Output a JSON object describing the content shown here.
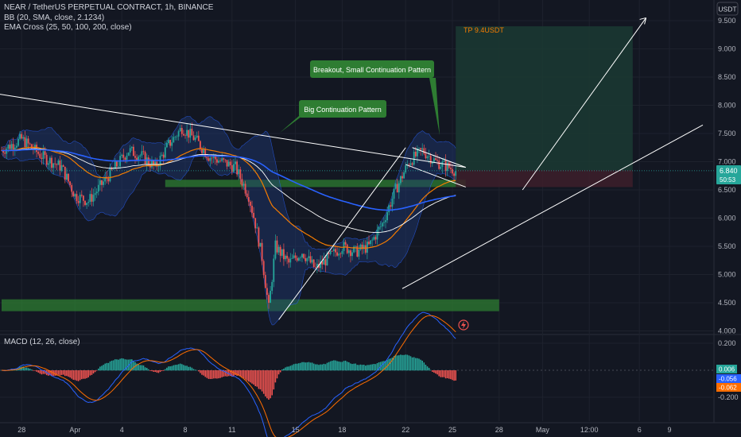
{
  "legend": {
    "symbol": "NEAR / TetherUS PERPETUAL CONTRACT, 1h, BINANCE",
    "bb": "BB (20, SMA, close, 2.1234)",
    "ema": "EMA Cross (25, 50, 100, 200, close)",
    "macd": "MACD (12, 26, close)"
  },
  "currency": "USDT",
  "annotations": {
    "big_pattern": "Big Continuation Pattern",
    "breakout": "Breakout, Small Continuation Pattern",
    "tp": "TP 9.4USDT"
  },
  "price_tag": {
    "value": "6.840",
    "countdown": "50:53"
  },
  "macd_tags": {
    "a": "0.006",
    "b": "-0.056",
    "c": "-0.062"
  },
  "colors": {
    "background": "#131722",
    "grid": "#1e222d",
    "text": "#b2b5be",
    "candle_up": "#26a69a",
    "candle_down": "#ef5350",
    "ema_fast": "#f57c00",
    "ema_white": "#ffffff",
    "ema_blue": "#2962ff",
    "bb_fill": "#1e3a75",
    "support_zone": "#2e7d32",
    "callout": "#2e7d32",
    "tp_zone": "#1b3a33",
    "sl_zone": "#3d1f2a",
    "price_tag": "#26a69a",
    "macd_line": "#2962ff",
    "signal_line": "#ff6d00"
  },
  "chart_data": {
    "type": "candlestick",
    "y_axis": {
      "ticks": [
        "9.500",
        "9.000",
        "8.500",
        "8.000",
        "7.500",
        "7.000",
        "6.500",
        "6.000",
        "5.500",
        "5.000",
        "4.500",
        "4.000"
      ],
      "ylim": [
        4.0,
        9.5
      ]
    },
    "x_axis": {
      "ticks": [
        "28",
        "Apr",
        "4",
        "8",
        "11",
        "15",
        "18",
        "22",
        "25",
        "28",
        "May",
        "12:00",
        "6",
        "9"
      ]
    },
    "macd_axis": {
      "ticks": [
        "0.200",
        "-0.200"
      ]
    },
    "price_path": [
      [
        0,
        7.2
      ],
      [
        6,
        7.4
      ],
      [
        12,
        7.1
      ],
      [
        18,
        6.9
      ],
      [
        22,
        6.4
      ],
      [
        26,
        6.3
      ],
      [
        30,
        6.6
      ],
      [
        34,
        6.9
      ],
      [
        38,
        7.2
      ],
      [
        42,
        7.1
      ],
      [
        46,
        6.9
      ],
      [
        50,
        7.3
      ],
      [
        54,
        7.6
      ],
      [
        58,
        7.4
      ],
      [
        62,
        7.1
      ],
      [
        66,
        7.0
      ],
      [
        70,
        6.9
      ],
      [
        74,
        6.4
      ],
      [
        76,
        5.9
      ],
      [
        78,
        5.3
      ],
      [
        80,
        4.4
      ],
      [
        82,
        5.5
      ],
      [
        86,
        5.2
      ],
      [
        90,
        5.4
      ],
      [
        94,
        5.1
      ],
      [
        98,
        5.3
      ],
      [
        102,
        5.5
      ],
      [
        106,
        5.4
      ],
      [
        110,
        5.5
      ],
      [
        114,
        5.9
      ],
      [
        118,
        6.5
      ],
      [
        122,
        7.0
      ],
      [
        126,
        7.2
      ],
      [
        130,
        7.0
      ],
      [
        134,
        6.9
      ],
      [
        136,
        6.84
      ]
    ],
    "trendlines": [
      {
        "from": [
          -1,
          8.2
        ],
        "to": [
          139,
          6.9
        ]
      },
      {
        "from": [
          83,
          4.2
        ],
        "to": [
          121,
          7.25
        ]
      },
      {
        "from": [
          123,
          7.25
        ],
        "to": [
          139,
          6.9
        ]
      },
      {
        "from": [
          121,
          6.95
        ],
        "to": [
          139,
          6.55
        ]
      },
      {
        "from": [
          156,
          6.5
        ],
        "to": [
          193,
          9.55
        ]
      },
      {
        "from": [
          120,
          4.75
        ],
        "to": [
          210,
          7.65
        ]
      }
    ],
    "zones": [
      {
        "kind": "support",
        "x0": 49,
        "x1": 139,
        "y0": 6.55,
        "y1": 6.68
      },
      {
        "kind": "support",
        "x0": 0,
        "x1": 149,
        "y0": 4.35,
        "y1": 4.56
      },
      {
        "kind": "take_profit",
        "x0": 136,
        "x1": 189,
        "y0": 6.85,
        "y1": 9.4
      },
      {
        "kind": "stop_loss",
        "x0": 136,
        "x1": 189,
        "y0": 6.55,
        "y1": 6.85
      }
    ]
  }
}
